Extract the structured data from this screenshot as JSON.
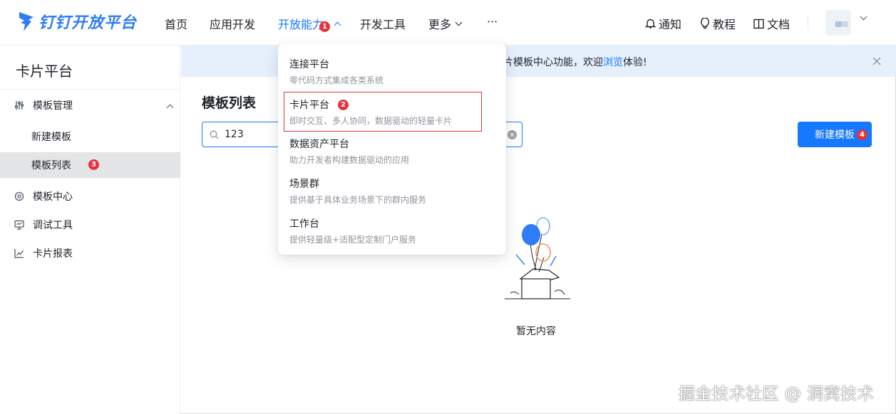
{
  "brand": {
    "name": "钉钉开放平台",
    "color": "#2f7df6"
  },
  "nav": {
    "items": [
      {
        "label": "首页"
      },
      {
        "label": "应用开发"
      },
      {
        "label": "开放能力",
        "active": true,
        "badge": "1"
      },
      {
        "label": "开发工具"
      },
      {
        "label": "更多"
      },
      {
        "label": "···"
      }
    ],
    "right": [
      {
        "label": "通知",
        "icon": "bell-icon"
      },
      {
        "label": "教程",
        "icon": "bulb-icon"
      },
      {
        "label": "文档",
        "icon": "book-icon"
      }
    ]
  },
  "sidebar": {
    "title": "卡片平台",
    "group": {
      "label": "模板管理",
      "icon": "sliders-icon",
      "expanded": true
    },
    "sub_items": [
      {
        "label": "新建模板"
      },
      {
        "label": "模板列表",
        "selected": true,
        "badge": "3"
      }
    ],
    "items": [
      {
        "label": "模板中心",
        "icon": "gear-icon"
      },
      {
        "label": "调试工具",
        "icon": "monitor-icon"
      },
      {
        "label": "卡片报表",
        "icon": "chart-icon"
      }
    ]
  },
  "banner": {
    "text_before": "片模板中心功能，欢迎",
    "link": "浏览",
    "text_after": "体验!"
  },
  "main": {
    "title": "模板列表",
    "search_value": "123",
    "new_button": "新建模板",
    "new_button_badge": "4",
    "empty_text": "暂无内容"
  },
  "dropdown": {
    "items": [
      {
        "title": "连接平台",
        "desc": "零代码方式集成各类系统"
      },
      {
        "title": "卡片平台",
        "desc": "即时交互、多人协同，数据驱动的轻量卡片",
        "badge": "2",
        "highlighted": true
      },
      {
        "title": "数据资产平台",
        "desc": "助力开发者构建数据驱动的应用"
      },
      {
        "title": "场景群",
        "desc": "提供基于具体业务场景下的群内服务"
      },
      {
        "title": "工作台",
        "desc": "提供轻量级+适配型定制门户服务"
      }
    ]
  },
  "watermark": "掘金技术社区 @ 洞窝技术",
  "colors": {
    "accent": "#1677ff",
    "badge": "#e8323c",
    "banner_bg": "#e6f0fd"
  }
}
